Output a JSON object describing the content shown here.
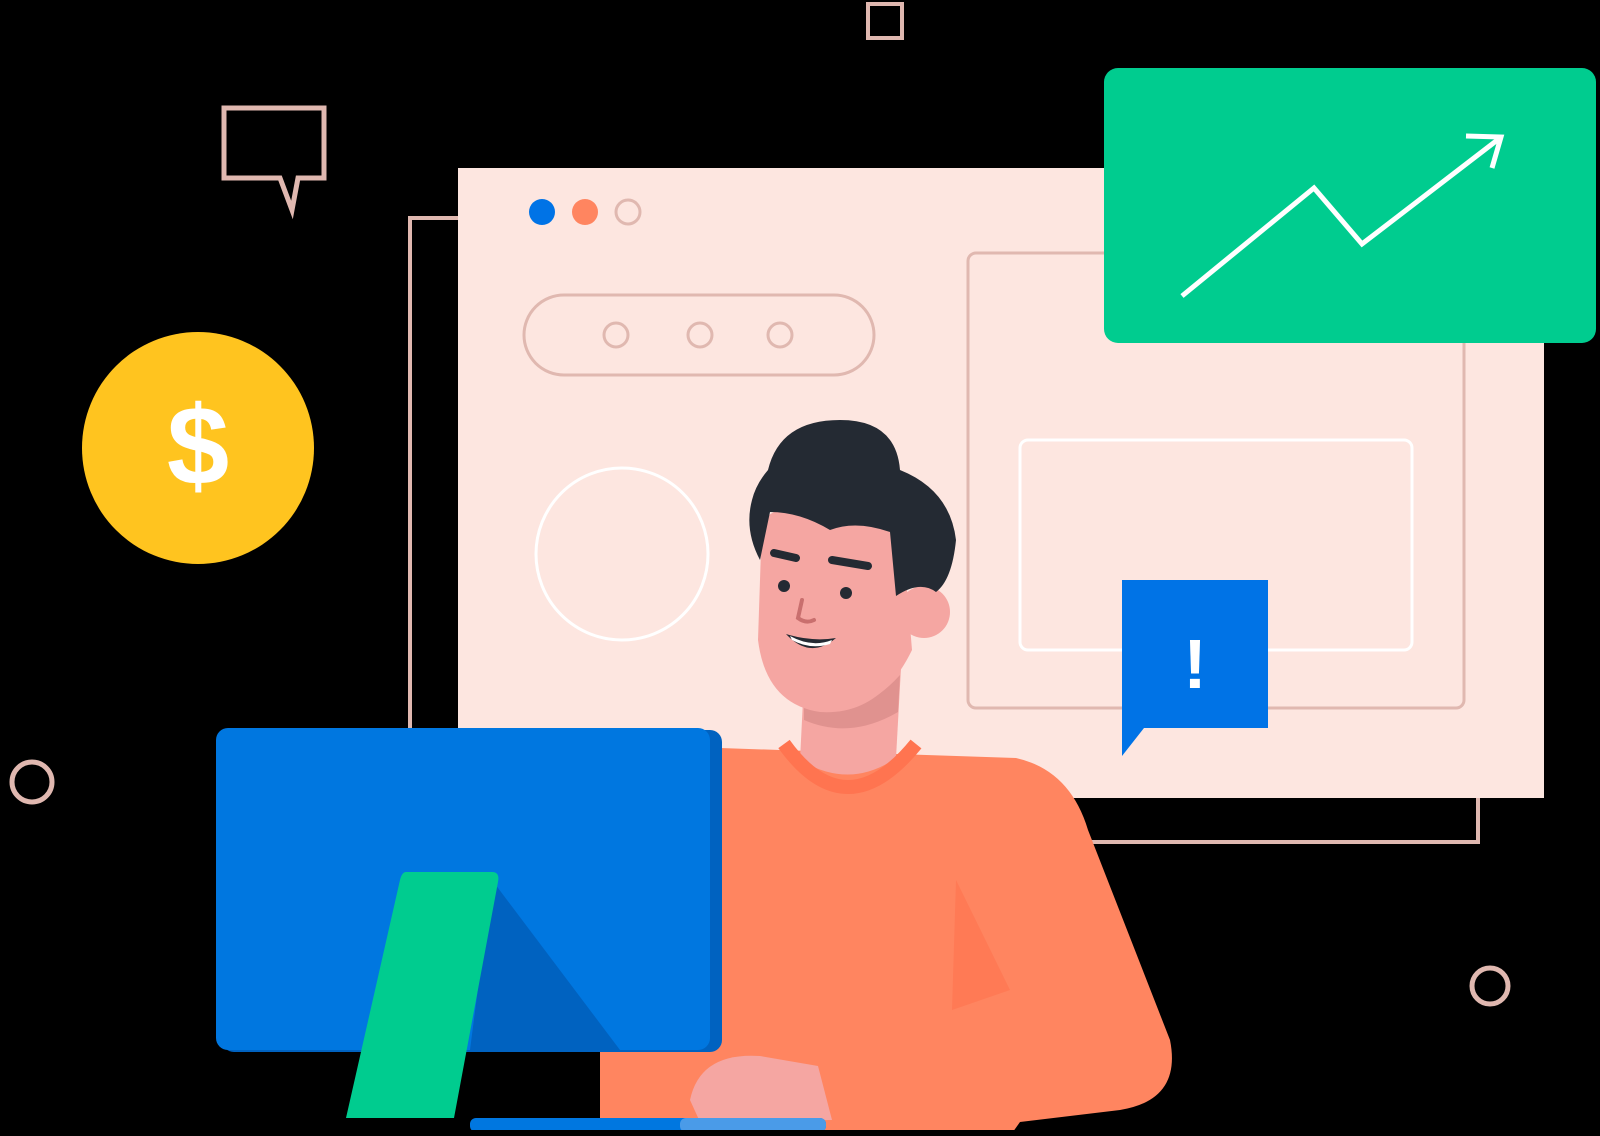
{
  "illustration": {
    "subject": "person-at-computer",
    "coin_symbol": "$",
    "alert_symbol": "!",
    "icons": [
      "dollar-coin-icon",
      "chat-bubble-icon",
      "trend-up-arrow-icon",
      "alert-bubble-icon",
      "browser-window-icon",
      "monitor-icon"
    ]
  },
  "colors": {
    "background": "#000000",
    "panel": "#fde6e0",
    "panel_outline": "#e0b8b0",
    "chart_card": "#00cc8f",
    "coin": "#ffc41f",
    "monitor": "#0077e0",
    "monitor_shade": "#0062c0",
    "monitor_stand": "#00cc8f",
    "alert_bubble": "#0073e6",
    "shirt": "#ff8560",
    "skin": "#f5a6a2",
    "hair": "#242a33",
    "dot_blue": "#0073e6",
    "dot_orange": "#ff8560"
  }
}
